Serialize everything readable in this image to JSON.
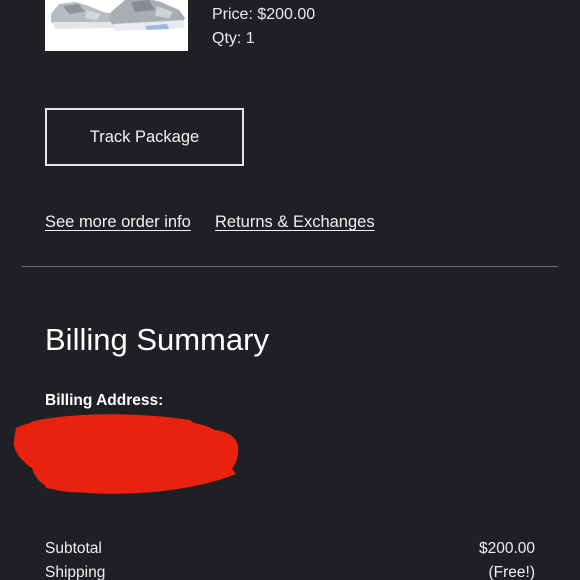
{
  "product": {
    "image_icon": "sneaker-image",
    "price_text": "Price: $200.00",
    "qty_text": "Qty: 1"
  },
  "actions": {
    "track_label": "Track Package",
    "more_info_label": "See more order info",
    "returns_label": "Returns & Exchanges"
  },
  "billing": {
    "title": "Billing Summary",
    "address_label": "Billing Address:",
    "redaction_color": "#e8220f"
  },
  "summary": {
    "rows": [
      {
        "label": "Subtotal",
        "value": "$200.00"
      },
      {
        "label": "Shipping",
        "value": "(Free!)"
      }
    ]
  },
  "colors": {
    "background": "#1f2024",
    "divider": "#6b6c70",
    "text": "#ffffff"
  }
}
